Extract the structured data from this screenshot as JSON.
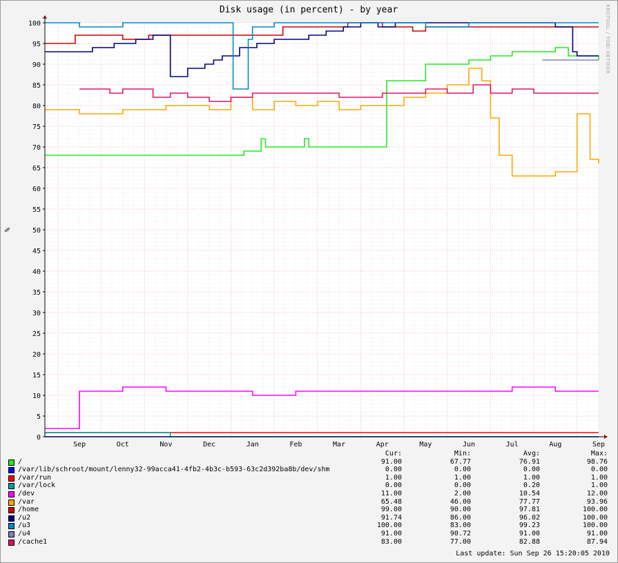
{
  "window": {
    "watermark": "RRDTOOL / TOBI OETIKER"
  },
  "chart_data": {
    "type": "line",
    "title": "Disk usage (in percent) - by year",
    "ylabel": "%",
    "xlabel": "",
    "ylim": [
      0,
      100
    ],
    "y_ticks": [
      0,
      5,
      10,
      15,
      20,
      25,
      30,
      35,
      40,
      45,
      50,
      55,
      60,
      65,
      70,
      75,
      80,
      85,
      90,
      95,
      100
    ],
    "x_months": [
      "Sep",
      "Oct",
      "Nov",
      "Dec",
      "Jan",
      "Feb",
      "Mar",
      "Apr",
      "May",
      "Jun",
      "Jul",
      "Aug",
      "Sep"
    ],
    "x_month_positions": [
      0.5,
      1.5,
      2.5,
      3.5,
      4.5,
      5.5,
      6.5,
      7.5,
      8.5,
      9.5,
      10.5,
      11.5,
      12.5
    ],
    "x_domain": [
      -0.3,
      12.5
    ],
    "grid": true,
    "legend_position": "bottom",
    "series": [
      {
        "name": "/",
        "color": "#22e822",
        "x": [
          -0.3,
          4.2,
          4.3,
          4.7,
          4.8,
          5.7,
          5.8,
          7.5,
          7.6,
          8.5,
          9.0,
          9.5,
          10.0,
          10.5,
          11.0,
          11.5,
          11.8,
          12.5
        ],
        "y": [
          68,
          68,
          69,
          72,
          70,
          72,
          70,
          70,
          86,
          90,
          90,
          91,
          92,
          93,
          93,
          94,
          92,
          91
        ]
      },
      {
        "name": "/var/lib/schroot/mount/lenny32-99acca41-4fb2-4b3c-b593-63c2d392ba8b/dev/shm",
        "color": "#0000ff",
        "x": [
          -0.3,
          12.5
        ],
        "y": [
          0,
          0
        ]
      },
      {
        "name": "/var/run",
        "color": "#ff0000",
        "x": [
          -0.3,
          12.5
        ],
        "y": [
          1,
          1
        ]
      },
      {
        "name": "/var/lock",
        "color": "#00a0a0",
        "x": [
          -0.3,
          2.5,
          2.6,
          12.5
        ],
        "y": [
          1,
          1,
          0,
          0
        ]
      },
      {
        "name": "/dev",
        "color": "#ff00ff",
        "x": [
          -0.3,
          0.4,
          0.5,
          1.5,
          2.5,
          3.5,
          4.5,
          5.5,
          6.5,
          7.5,
          8.5,
          9.5,
          10.5,
          11.5,
          12.5
        ],
        "y": [
          2,
          2,
          11,
          12,
          11,
          11,
          10,
          11,
          11,
          11,
          11,
          11,
          12,
          11,
          11
        ]
      },
      {
        "name": "/var",
        "color": "#ffa500",
        "x": [
          -0.3,
          0.5,
          1.5,
          2.5,
          3.5,
          4.0,
          4.5,
          5.0,
          5.5,
          6.0,
          6.5,
          7.0,
          7.5,
          8.0,
          8.5,
          9.0,
          9.5,
          9.8,
          10.0,
          10.2,
          10.5,
          11.0,
          11.5,
          12.0,
          12.3,
          12.5
        ],
        "y": [
          79,
          78,
          79,
          80,
          79,
          82,
          79,
          81,
          80,
          81,
          79,
          80,
          80,
          82,
          83,
          85,
          89,
          86,
          77,
          68,
          63,
          63,
          64,
          78,
          67,
          66
        ]
      },
      {
        "name": "/home",
        "color": "#cc0000",
        "x": [
          -0.3,
          0.3,
          0.4,
          1.2,
          1.5,
          2.1,
          2.7,
          3.7,
          4.2,
          5.2,
          5.7,
          6.7,
          7.5,
          8.2,
          8.5,
          9.5,
          10.5,
          11.5,
          12.5
        ],
        "y": [
          95,
          95,
          97,
          97,
          96,
          97,
          97,
          97,
          97,
          99,
          99,
          100,
          99,
          98,
          99,
          99,
          99,
          99,
          99
        ]
      },
      {
        "name": "/u2",
        "color": "#000080",
        "x": [
          -0.3,
          0.8,
          1.3,
          1.8,
          2.2,
          2.6,
          3.0,
          3.4,
          3.6,
          3.8,
          4.2,
          4.6,
          5.0,
          5.4,
          5.8,
          6.2,
          6.6,
          7.0,
          7.4,
          7.8,
          8.5,
          9.5,
          10.5,
          11.5,
          11.9,
          12.0,
          12.4,
          12.5
        ],
        "y": [
          93,
          94,
          95,
          96,
          97,
          87,
          89,
          90,
          91,
          92,
          94,
          95,
          96,
          96,
          97,
          98,
          99,
          100,
          99,
          100,
          100,
          100,
          100,
          99,
          93,
          92,
          92,
          92
        ]
      },
      {
        "name": "/u3",
        "color": "#0088cc",
        "x": [
          -0.3,
          0.5,
          1.5,
          2.5,
          3.5,
          4.0,
          4.05,
          4.3,
          4.4,
          4.5,
          5.0,
          5.5,
          6.5,
          7.5,
          8.5,
          9.5,
          10.5,
          11.5,
          12.5
        ],
        "y": [
          100,
          99,
          100,
          100,
          100,
          100,
          84,
          84,
          96,
          99,
          100,
          100,
          100,
          100,
          99,
          100,
          100,
          100,
          100
        ]
      },
      {
        "name": "/u4",
        "color": "#8080c0",
        "x": [
          11.2,
          12.5
        ],
        "y": [
          91,
          91
        ]
      },
      {
        "name": "/cache1",
        "color": "#e0106a",
        "x": [
          0.5,
          1.0,
          1.2,
          1.5,
          2.2,
          2.6,
          3.0,
          3.5,
          4.0,
          4.5,
          5.5,
          6.5,
          7.5,
          8.5,
          9.0,
          9.6,
          10.0,
          10.5,
          11.0,
          11.5,
          12.0,
          12.5
        ],
        "y": [
          84,
          84,
          83,
          84,
          82,
          83,
          82,
          81,
          82,
          83,
          83,
          82,
          83,
          84,
          83,
          85,
          83,
          84,
          83,
          83,
          83,
          83
        ]
      }
    ]
  },
  "legend": {
    "headers": [
      "Cur:",
      "Min:",
      "Avg:",
      "Max:"
    ],
    "rows": [
      {
        "label": "/",
        "color": "#22e822",
        "cur": "91.00",
        "min": "67.77",
        "avg": "76.91",
        "max": "98.76"
      },
      {
        "label": "/var/lib/schroot/mount/lenny32-99acca41-4fb2-4b3c-b593-63c2d392ba8b/dev/shm",
        "color": "#0000ff",
        "cur": "0.00",
        "min": "0.00",
        "avg": "0.00",
        "max": "0.00"
      },
      {
        "label": "/var/run",
        "color": "#ff0000",
        "cur": "1.00",
        "min": "1.00",
        "avg": "1.00",
        "max": "1.00"
      },
      {
        "label": "/var/lock",
        "color": "#00a0a0",
        "cur": "0.00",
        "min": "0.00",
        "avg": "0.20",
        "max": "1.00"
      },
      {
        "label": "/dev",
        "color": "#ff00ff",
        "cur": "11.00",
        "min": "2.00",
        "avg": "10.54",
        "max": "12.00"
      },
      {
        "label": "/var",
        "color": "#ffa500",
        "cur": "65.48",
        "min": "46.00",
        "avg": "77.77",
        "max": "93.96"
      },
      {
        "label": "/home",
        "color": "#cc0000",
        "cur": "99.00",
        "min": "90.00",
        "avg": "97.81",
        "max": "100.00"
      },
      {
        "label": "/u2",
        "color": "#000080",
        "cur": "91.74",
        "min": "86.00",
        "avg": "96.02",
        "max": "100.00"
      },
      {
        "label": "/u3",
        "color": "#0088cc",
        "cur": "100.00",
        "min": "83.00",
        "avg": "99.23",
        "max": "100.00"
      },
      {
        "label": "/u4",
        "color": "#8080c0",
        "cur": "91.00",
        "min": "90.72",
        "avg": "91.00",
        "max": "91.00"
      },
      {
        "label": "/cache1",
        "color": "#e0106a",
        "cur": "83.00",
        "min": "77.00",
        "avg": "82.88",
        "max": "87.94"
      }
    ],
    "last_update": "Last update: Sun Sep 26 15:20:05 2010"
  }
}
